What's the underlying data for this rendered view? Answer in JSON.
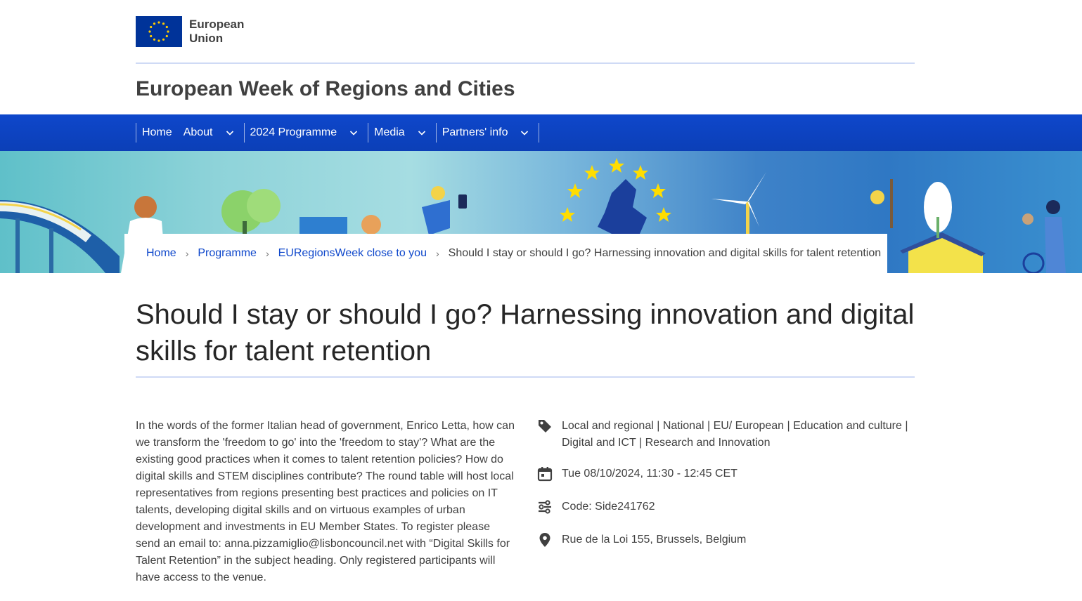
{
  "logo": {
    "line1": "European",
    "line2": "Union"
  },
  "site": {
    "title": "European Week of Regions and Cities"
  },
  "nav": {
    "items": [
      {
        "label": "Home",
        "dropdown": false
      },
      {
        "label": "About",
        "dropdown": true
      },
      {
        "label": "2024 Programme",
        "dropdown": true
      },
      {
        "label": "Media",
        "dropdown": true
      },
      {
        "label": "Partners' info",
        "dropdown": true
      }
    ]
  },
  "breadcrumb": {
    "items": [
      "Home",
      "Programme",
      "EURegionsWeek close to you"
    ],
    "current": "Should I stay or should I go? Harnessing innovation and digital skills for talent retention",
    "separator": "›"
  },
  "page": {
    "title": "Should I stay or should I go? Harnessing innovation and digital skills for talent retention",
    "description": "In the words of the former Italian head of government, Enrico Letta, how can we transform the 'freedom to go' into the 'freedom to stay'? What are the existing good practices when it comes to talent retention policies? How do digital skills and STEM disciplines contribute? The round table will host local representatives from regions presenting best practices and policies on IT talents, developing digital skills and on virtuous examples of urban development and investments in EU Member States. To register please send an email to: anna.pizzamiglio@lisboncouncil.net with “Digital Skills for Talent Retention” in the subject heading. Only registered participants will have access to the venue."
  },
  "meta": {
    "tags": "Local and regional | National | EU/ European | Education and culture | Digital and ICT | Research and Innovation",
    "date": "Tue 08/10/2024, 11:30 - 12:45 CET",
    "code": "Code: Side241762",
    "location": "Rue de la Loi 155, Brussels, Belgium"
  },
  "icons": {
    "tags": "tag-icon",
    "date": "calendar-icon",
    "code": "code-icon",
    "location": "location-pin-icon"
  },
  "colors": {
    "nav_blue": "#0e47cb",
    "link_blue": "#0e47cb",
    "eu_flag_blue": "#003399",
    "eu_star_yellow": "#ffcc00",
    "rule": "#cfdaf5"
  }
}
